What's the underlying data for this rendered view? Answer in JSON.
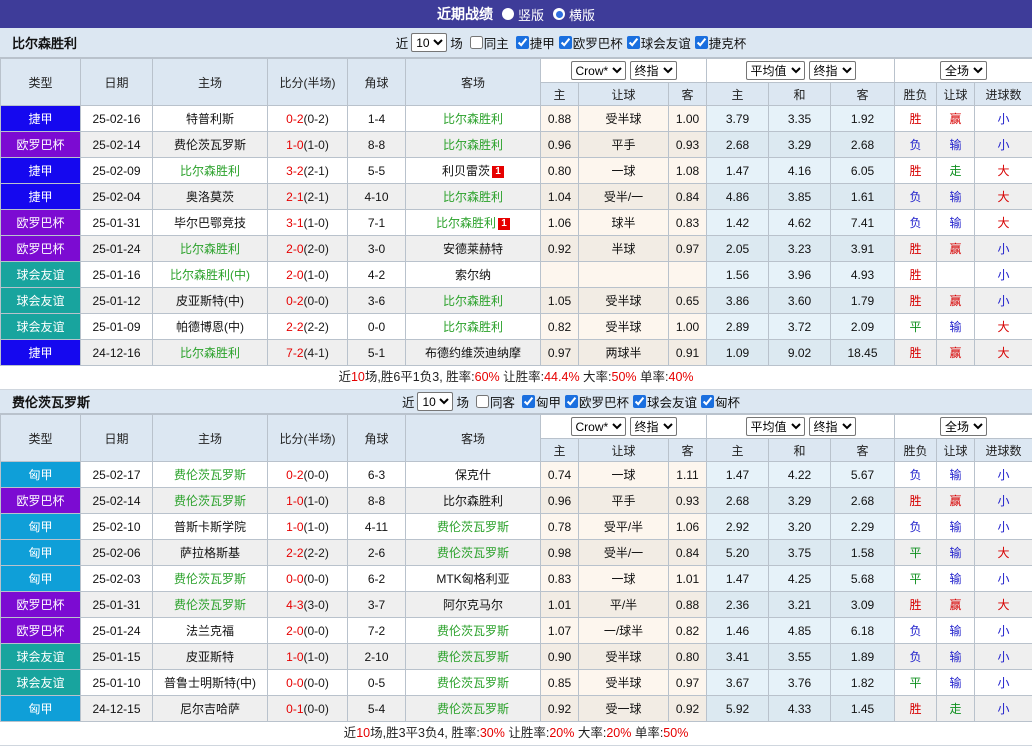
{
  "titlebar": {
    "title": "近期战绩",
    "options": [
      {
        "label": "竖版",
        "selected": false
      },
      {
        "label": "横版",
        "selected": true
      }
    ]
  },
  "colors": {
    "titlebar_bg": "#3e3c99",
    "header_bg": "#dce7f2",
    "team_highlight_green": "#2aa12a",
    "score_red": "#e60000",
    "result_red": "#d70000",
    "result_blue": "#2222cc",
    "result_green": "#0e8f1e",
    "badge_red": "#e60000"
  },
  "type_colors": {
    "捷甲": "#1508ef",
    "欧罗巴杯": "#7c0bd2",
    "球会友谊": "#18a49e",
    "匈甲": "#0f9fd8",
    "捷克杯": "#1508ef",
    "匈杯": "#0f9fd8"
  },
  "result_colors": {
    "胜": "#d70000",
    "赢": "#d70000",
    "大": "#d70000",
    "负": "#2222cc",
    "输": "#2222cc",
    "小": "#2222cc",
    "平": "#0e8f1e",
    "走": "#0e8f1e"
  },
  "table_headers": {
    "type": "类型",
    "date": "日期",
    "home": "主场",
    "score": "比分(半场)",
    "corner": "角球",
    "away": "客场",
    "selects": [
      "Crow*",
      "终指",
      "平均值",
      "终指",
      "全场"
    ],
    "sub": [
      "主",
      "让球",
      "客",
      "主",
      "和",
      "客",
      "胜负",
      "让球",
      "进球数"
    ]
  },
  "sections": [
    {
      "team": "比尔森胜利",
      "filter": {
        "near_label": "近",
        "count": "10",
        "games_label": "场",
        "same": {
          "label": "同主",
          "checked": false
        },
        "leagues": [
          {
            "label": "捷甲",
            "checked": true
          },
          {
            "label": "欧罗巴杯",
            "checked": true
          },
          {
            "label": "球会友谊",
            "checked": true
          },
          {
            "label": "捷克杯",
            "checked": true
          }
        ]
      },
      "rows": [
        {
          "type": "捷甲",
          "date": "25-02-16",
          "home": "特普利斯",
          "hg": false,
          "hb": "",
          "ft": "0-2",
          "ht": "(0-2)",
          "corner": "1-4",
          "away": "比尔森胜利",
          "ag": true,
          "ab": "",
          "odds": [
            "0.88",
            "受半球",
            "1.00"
          ],
          "avg": [
            "3.79",
            "3.35",
            "1.92"
          ],
          "res": [
            "胜",
            "赢",
            "小"
          ]
        },
        {
          "type": "欧罗巴杯",
          "date": "25-02-14",
          "home": "费伦茨瓦罗斯",
          "hg": false,
          "hb": "",
          "ft": "1-0",
          "ht": "(1-0)",
          "corner": "8-8",
          "away": "比尔森胜利",
          "ag": true,
          "ab": "",
          "odds": [
            "0.96",
            "平手",
            "0.93"
          ],
          "avg": [
            "2.68",
            "3.29",
            "2.68"
          ],
          "res": [
            "负",
            "输",
            "小"
          ]
        },
        {
          "type": "捷甲",
          "date": "25-02-09",
          "home": "比尔森胜利",
          "hg": true,
          "hb": "",
          "ft": "3-2",
          "ht": "(2-1)",
          "corner": "5-5",
          "away": "利贝雷茨",
          "ag": false,
          "ab": "1",
          "odds": [
            "0.80",
            "一球",
            "1.08"
          ],
          "avg": [
            "1.47",
            "4.16",
            "6.05"
          ],
          "res": [
            "胜",
            "走",
            "大"
          ]
        },
        {
          "type": "捷甲",
          "date": "25-02-04",
          "home": "奥洛莫茨",
          "hg": false,
          "hb": "",
          "ft": "2-1",
          "ht": "(2-1)",
          "corner": "4-10",
          "away": "比尔森胜利",
          "ag": true,
          "ab": "",
          "odds": [
            "1.04",
            "受半/一",
            "0.84"
          ],
          "avg": [
            "4.86",
            "3.85",
            "1.61"
          ],
          "res": [
            "负",
            "输",
            "大"
          ]
        },
        {
          "type": "欧罗巴杯",
          "date": "25-01-31",
          "home": "毕尔巴鄂竞技",
          "hg": false,
          "hb": "",
          "ft": "3-1",
          "ht": "(1-0)",
          "corner": "7-1",
          "away": "比尔森胜利",
          "ag": true,
          "ab": "1",
          "odds": [
            "1.06",
            "球半",
            "0.83"
          ],
          "avg": [
            "1.42",
            "4.62",
            "7.41"
          ],
          "res": [
            "负",
            "输",
            "大"
          ]
        },
        {
          "type": "欧罗巴杯",
          "date": "25-01-24",
          "home": "比尔森胜利",
          "hg": true,
          "hb": "",
          "ft": "2-0",
          "ht": "(2-0)",
          "corner": "3-0",
          "away": "安德莱赫特",
          "ag": false,
          "ab": "",
          "odds": [
            "0.92",
            "半球",
            "0.97"
          ],
          "avg": [
            "2.05",
            "3.23",
            "3.91"
          ],
          "res": [
            "胜",
            "赢",
            "小"
          ]
        },
        {
          "type": "球会友谊",
          "date": "25-01-16",
          "home": "比尔森胜利(中)",
          "hg": true,
          "hb": "",
          "ft": "2-0",
          "ht": "(1-0)",
          "corner": "4-2",
          "away": "索尔纳",
          "ag": false,
          "ab": "",
          "odds": [
            "",
            "",
            ""
          ],
          "avg": [
            "1.56",
            "3.96",
            "4.93"
          ],
          "res": [
            "胜",
            "",
            "小"
          ]
        },
        {
          "type": "球会友谊",
          "date": "25-01-12",
          "home": "皮亚斯特(中)",
          "hg": false,
          "hb": "",
          "ft": "0-2",
          "ht": "(0-0)",
          "corner": "3-6",
          "away": "比尔森胜利",
          "ag": true,
          "ab": "",
          "odds": [
            "1.05",
            "受半球",
            "0.65"
          ],
          "avg": [
            "3.86",
            "3.60",
            "1.79"
          ],
          "res": [
            "胜",
            "赢",
            "小"
          ]
        },
        {
          "type": "球会友谊",
          "date": "25-01-09",
          "home": "帕德博恩(中)",
          "hg": false,
          "hb": "",
          "ft": "2-2",
          "ht": "(2-2)",
          "corner": "0-0",
          "away": "比尔森胜利",
          "ag": true,
          "ab": "",
          "odds": [
            "0.82",
            "受半球",
            "1.00"
          ],
          "avg": [
            "2.89",
            "3.72",
            "2.09"
          ],
          "res": [
            "平",
            "输",
            "大"
          ]
        },
        {
          "type": "捷甲",
          "date": "24-12-16",
          "home": "比尔森胜利",
          "hg": true,
          "hb": "",
          "ft": "7-2",
          "ht": "(4-1)",
          "corner": "5-1",
          "away": "布德约维茨迪纳摩",
          "ag": false,
          "ab": "",
          "odds": [
            "0.97",
            "两球半",
            "0.91"
          ],
          "avg": [
            "1.09",
            "9.02",
            "18.45"
          ],
          "res": [
            "胜",
            "赢",
            "大"
          ]
        }
      ],
      "summary": [
        [
          "近",
          "k"
        ],
        [
          "10",
          "r"
        ],
        [
          "场,胜6平1负3, 胜率:",
          "k"
        ],
        [
          "60%",
          "r"
        ],
        [
          " 让胜率:",
          "k"
        ],
        [
          "44.4%",
          "r"
        ],
        [
          " 大率:",
          "k"
        ],
        [
          "50%",
          "r"
        ],
        [
          " 单率:",
          "k"
        ],
        [
          "40%",
          "r"
        ]
      ]
    },
    {
      "team": "费伦茨瓦罗斯",
      "filter": {
        "near_label": "近",
        "count": "10",
        "games_label": "场",
        "same": {
          "label": "同客",
          "checked": false
        },
        "leagues": [
          {
            "label": "匈甲",
            "checked": true
          },
          {
            "label": "欧罗巴杯",
            "checked": true
          },
          {
            "label": "球会友谊",
            "checked": true
          },
          {
            "label": "匈杯",
            "checked": true
          }
        ]
      },
      "rows": [
        {
          "type": "匈甲",
          "date": "25-02-17",
          "home": "费伦茨瓦罗斯",
          "hg": true,
          "hb": "",
          "ft": "0-2",
          "ht": "(0-0)",
          "corner": "6-3",
          "away": "保克什",
          "ag": false,
          "ab": "",
          "odds": [
            "0.74",
            "一球",
            "1.11"
          ],
          "avg": [
            "1.47",
            "4.22",
            "5.67"
          ],
          "res": [
            "负",
            "输",
            "小"
          ]
        },
        {
          "type": "欧罗巴杯",
          "date": "25-02-14",
          "home": "费伦茨瓦罗斯",
          "hg": true,
          "hb": "",
          "ft": "1-0",
          "ht": "(1-0)",
          "corner": "8-8",
          "away": "比尔森胜利",
          "ag": false,
          "ab": "",
          "odds": [
            "0.96",
            "平手",
            "0.93"
          ],
          "avg": [
            "2.68",
            "3.29",
            "2.68"
          ],
          "res": [
            "胜",
            "赢",
            "小"
          ]
        },
        {
          "type": "匈甲",
          "date": "25-02-10",
          "home": "普斯卡斯学院",
          "hg": false,
          "hb": "",
          "ft": "1-0",
          "ht": "(1-0)",
          "corner": "4-11",
          "away": "费伦茨瓦罗斯",
          "ag": true,
          "ab": "",
          "odds": [
            "0.78",
            "受平/半",
            "1.06"
          ],
          "avg": [
            "2.92",
            "3.20",
            "2.29"
          ],
          "res": [
            "负",
            "输",
            "小"
          ]
        },
        {
          "type": "匈甲",
          "date": "25-02-06",
          "home": "萨拉格斯基",
          "hg": false,
          "hb": "",
          "ft": "2-2",
          "ht": "(2-2)",
          "corner": "2-6",
          "away": "费伦茨瓦罗斯",
          "ag": true,
          "ab": "",
          "odds": [
            "0.98",
            "受半/一",
            "0.84"
          ],
          "avg": [
            "5.20",
            "3.75",
            "1.58"
          ],
          "res": [
            "平",
            "输",
            "大"
          ]
        },
        {
          "type": "匈甲",
          "date": "25-02-03",
          "home": "费伦茨瓦罗斯",
          "hg": true,
          "hb": "",
          "ft": "0-0",
          "ht": "(0-0)",
          "corner": "6-2",
          "away": "MTK匈格利亚",
          "ag": false,
          "ab": "",
          "odds": [
            "0.83",
            "一球",
            "1.01"
          ],
          "avg": [
            "1.47",
            "4.25",
            "5.68"
          ],
          "res": [
            "平",
            "输",
            "小"
          ]
        },
        {
          "type": "欧罗巴杯",
          "date": "25-01-31",
          "home": "费伦茨瓦罗斯",
          "hg": true,
          "hb": "",
          "ft": "4-3",
          "ht": "(3-0)",
          "corner": "3-7",
          "away": "阿尔克马尔",
          "ag": false,
          "ab": "",
          "odds": [
            "1.01",
            "平/半",
            "0.88"
          ],
          "avg": [
            "2.36",
            "3.21",
            "3.09"
          ],
          "res": [
            "胜",
            "赢",
            "大"
          ]
        },
        {
          "type": "欧罗巴杯",
          "date": "25-01-24",
          "home": "法兰克福",
          "hg": false,
          "hb": "",
          "ft": "2-0",
          "ht": "(0-0)",
          "corner": "7-2",
          "away": "费伦茨瓦罗斯",
          "ag": true,
          "ab": "",
          "odds": [
            "1.07",
            "一/球半",
            "0.82"
          ],
          "avg": [
            "1.46",
            "4.85",
            "6.18"
          ],
          "res": [
            "负",
            "输",
            "小"
          ]
        },
        {
          "type": "球会友谊",
          "date": "25-01-15",
          "home": "皮亚斯特",
          "hg": false,
          "hb": "",
          "ft": "1-0",
          "ht": "(1-0)",
          "corner": "2-10",
          "away": "费伦茨瓦罗斯",
          "ag": true,
          "ab": "",
          "odds": [
            "0.90",
            "受半球",
            "0.80"
          ],
          "avg": [
            "3.41",
            "3.55",
            "1.89"
          ],
          "res": [
            "负",
            "输",
            "小"
          ]
        },
        {
          "type": "球会友谊",
          "date": "25-01-10",
          "home": "普鲁士明斯特(中)",
          "hg": false,
          "hb": "",
          "ft": "0-0",
          "ht": "(0-0)",
          "corner": "0-5",
          "away": "费伦茨瓦罗斯",
          "ag": true,
          "ab": "",
          "odds": [
            "0.85",
            "受半球",
            "0.97"
          ],
          "avg": [
            "3.67",
            "3.76",
            "1.82"
          ],
          "res": [
            "平",
            "输",
            "小"
          ]
        },
        {
          "type": "匈甲",
          "date": "24-12-15",
          "home": "尼尔吉哈萨",
          "hg": false,
          "hb": "",
          "ft": "0-1",
          "ht": "(0-0)",
          "corner": "5-4",
          "away": "费伦茨瓦罗斯",
          "ag": true,
          "ab": "",
          "odds": [
            "0.92",
            "受一球",
            "0.92"
          ],
          "avg": [
            "5.92",
            "4.33",
            "1.45"
          ],
          "res": [
            "胜",
            "走",
            "小"
          ]
        }
      ],
      "summary": [
        [
          "近",
          "k"
        ],
        [
          "10",
          "r"
        ],
        [
          "场,胜3平3负4, 胜率:",
          "k"
        ],
        [
          "30%",
          "r"
        ],
        [
          " 让胜率:",
          "k"
        ],
        [
          "20%",
          "r"
        ],
        [
          " 大率:",
          "k"
        ],
        [
          "20%",
          "r"
        ],
        [
          " 单率:",
          "k"
        ],
        [
          "50%",
          "r"
        ]
      ]
    }
  ]
}
